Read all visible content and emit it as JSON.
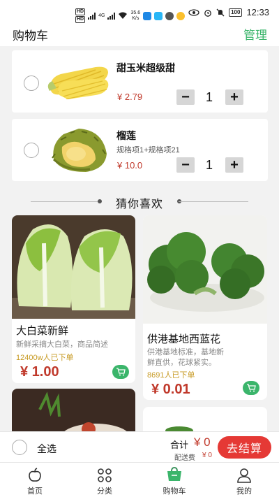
{
  "status_bar": {
    "network_tag_1": "HD",
    "network_tag_2": "HD",
    "signal_label": "4G",
    "speed_value": "35.6",
    "speed_unit": "K/s",
    "battery": "100",
    "time": "12:33"
  },
  "header": {
    "title": "购物车",
    "manage": "管理"
  },
  "cart_items": [
    {
      "name": "甜玉米超级甜",
      "spec": "",
      "price": "¥ 2.79",
      "quantity": "1",
      "minus": "−",
      "plus": "+"
    },
    {
      "name": "榴莲",
      "spec": "规格项1+规格项21",
      "price": "¥ 10.0",
      "quantity": "1",
      "minus": "−",
      "plus": "+"
    }
  ],
  "recommend": {
    "title": "猜你喜欢",
    "items": [
      {
        "name": "大白菜新鲜",
        "desc": "新鲜采摘大白菜，商品简述",
        "sold": "12400w人已下单",
        "price": "¥ 1.00"
      },
      {
        "name": "供港基地西蓝花",
        "desc": "供港基地标准，基地新鲜直供，花球紧实。",
        "sold": "8691人已下单",
        "price": "¥ 0.01"
      }
    ]
  },
  "checkout": {
    "select_all": "全选",
    "total_label": "合计",
    "total_value": "¥ 0",
    "delivery_label": "配送费",
    "delivery_value": "¥ 0",
    "button": "去结算"
  },
  "tabs": [
    {
      "label": "首页",
      "icon": "home-icon"
    },
    {
      "label": "分类",
      "icon": "category-icon"
    },
    {
      "label": "购物车",
      "icon": "cart-icon",
      "active": true
    },
    {
      "label": "我的",
      "icon": "profile-icon"
    }
  ],
  "colors": {
    "accent_green": "#3bb56b",
    "price_red": "#c0392b",
    "checkout_red": "#e53935",
    "sold_gold": "#c79a23"
  }
}
